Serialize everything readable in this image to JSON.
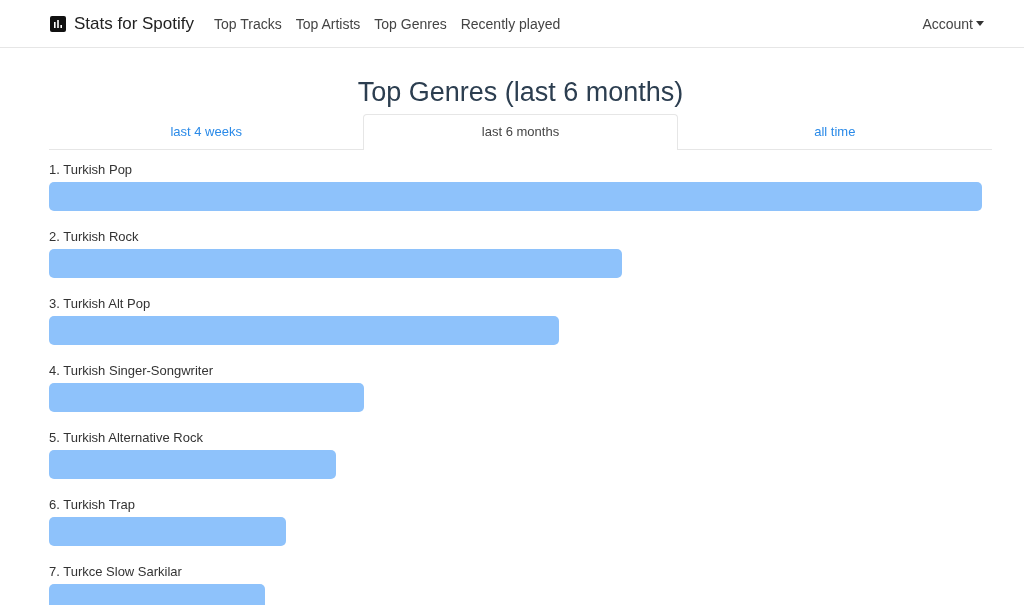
{
  "navbar": {
    "brand": "Stats for Spotify",
    "links": [
      "Top Tracks",
      "Top Artists",
      "Top Genres",
      "Recently played"
    ],
    "account": "Account"
  },
  "title": "Top Genres (last 6 months)",
  "tabs": [
    {
      "label": "last 4 weeks",
      "selected": false
    },
    {
      "label": "last 6 months",
      "selected": true
    },
    {
      "label": "all time",
      "selected": false
    }
  ],
  "genres": [
    {
      "label": "1. Turkish Pop"
    },
    {
      "label": "2. Turkish Rock"
    },
    {
      "label": "3. Turkish Alt Pop"
    },
    {
      "label": "4. Turkish Singer-Songwriter"
    },
    {
      "label": "5. Turkish Alternative Rock"
    },
    {
      "label": "6. Turkish Trap"
    },
    {
      "label": "7. Turkce Slow Sarkilar"
    }
  ]
}
